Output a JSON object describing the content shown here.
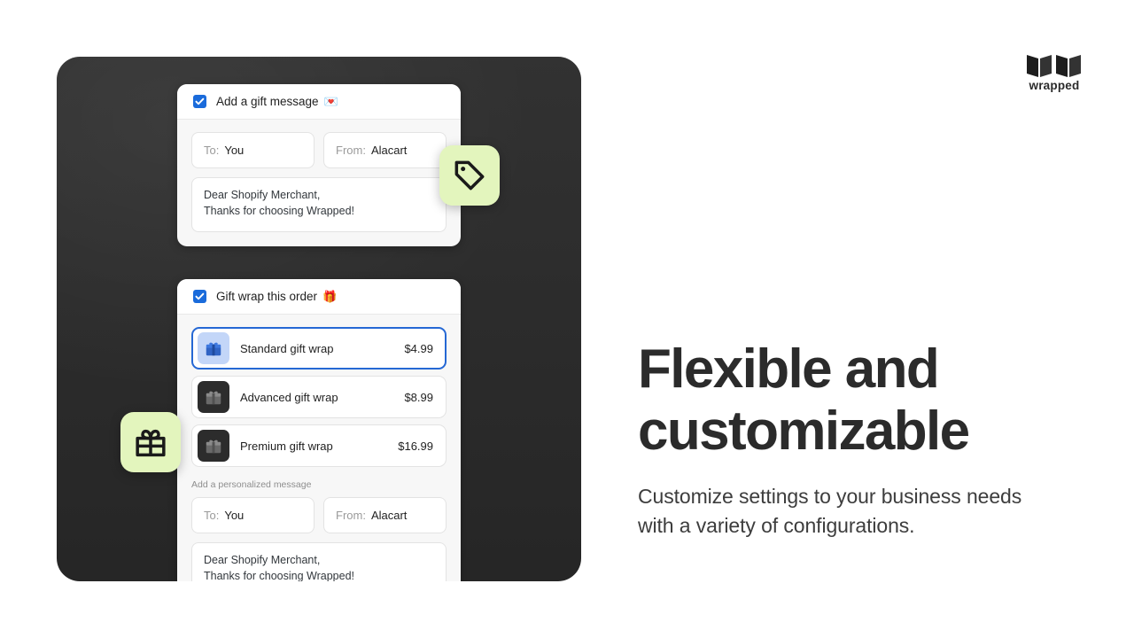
{
  "brand": {
    "name": "wrapped",
    "logo_icon": "folded-paper-mark"
  },
  "device": {
    "background_color": "#2b2b2b"
  },
  "badges": [
    {
      "icon": "tag-icon",
      "background_color": "#e3f5bd"
    },
    {
      "icon": "gift-icon",
      "background_color": "#e3f5bd"
    }
  ],
  "cards": {
    "gift_message": {
      "checkbox_checked": true,
      "checkbox_color": "#1a6bdb",
      "title": "Add a gift message",
      "title_emoji": "💌",
      "to_label": "To:",
      "to_value": "You",
      "from_label": "From:",
      "from_value": "Alacart",
      "message_line_1": "Dear Shopify Merchant,",
      "message_line_2": "Thanks for choosing Wrapped!"
    },
    "gift_wrap": {
      "checkbox_checked": true,
      "checkbox_color": "#1a6bdb",
      "title": "Gift wrap this order",
      "title_emoji": "🎁",
      "options": [
        {
          "name": "Standard gift wrap",
          "price": "$4.99",
          "selected": true,
          "icon": "gift-box-icon",
          "icon_style": "blue"
        },
        {
          "name": "Advanced gift wrap",
          "price": "$8.99",
          "selected": false,
          "icon": "gift-box-icon",
          "icon_style": "dark"
        },
        {
          "name": "Premium gift wrap",
          "price": "$16.99",
          "selected": false,
          "icon": "gift-box-icon",
          "icon_style": "dark"
        }
      ],
      "personalized_label": "Add a personalized message",
      "to_label": "To:",
      "to_value": "You",
      "from_label": "From:",
      "from_value": "Alacart",
      "message_line_1": "Dear Shopify Merchant,",
      "message_line_2": "Thanks for choosing Wrapped!"
    }
  },
  "copy": {
    "headline_line_1": "Flexible and",
    "headline_line_2": "customizable",
    "subhead_line_1": "Customize settings to your business needs",
    "subhead_line_2": "with a variety of configurations."
  }
}
